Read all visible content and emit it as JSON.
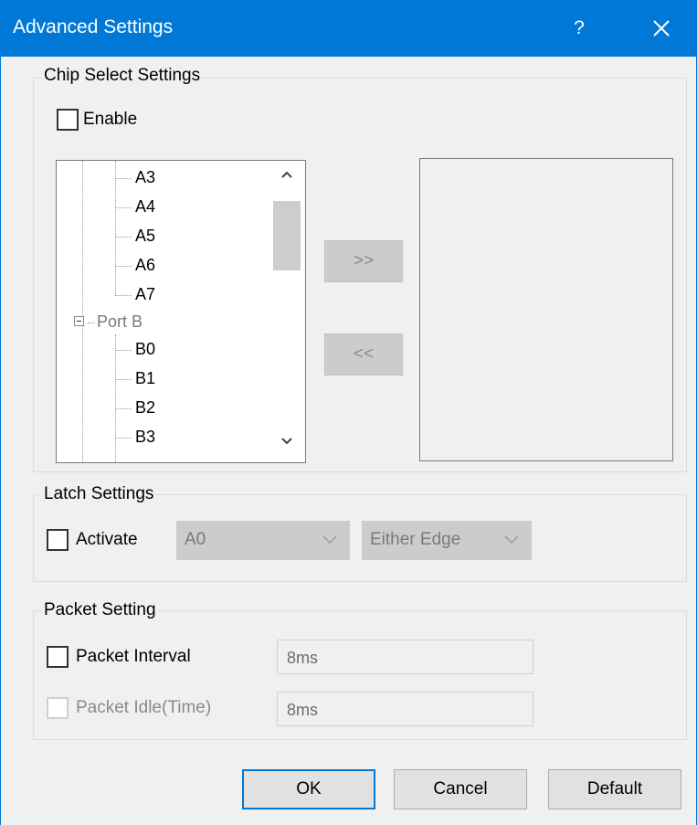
{
  "window": {
    "title": "Advanced Settings",
    "help_glyph": "?",
    "close_icon": "close-icon"
  },
  "chip_select": {
    "group_label": "Chip Select Settings",
    "enable_label": "Enable",
    "tree_items": [
      "A3",
      "A4",
      "A5",
      "A6",
      "A7"
    ],
    "tree_parent": "Port B",
    "tree_children": [
      "B0",
      "B1",
      "B2",
      "B3"
    ],
    "move_right_label": ">>",
    "move_left_label": "<<"
  },
  "latch": {
    "group_label": "Latch Settings",
    "activate_label": "Activate",
    "pin_value": "A0",
    "edge_value": "Either Edge"
  },
  "packet": {
    "group_label": "Packet Setting",
    "interval_label": "Packet Interval",
    "interval_value": "8ms",
    "idle_label": "Packet Idle(Time)",
    "idle_value": "8ms"
  },
  "footer": {
    "ok_label": "OK",
    "cancel_label": "Cancel",
    "default_label": "Default"
  },
  "colors": {
    "titlebar": "#0078d7",
    "window_bg": "#f0f0f0",
    "disabled": "#cccccc"
  }
}
